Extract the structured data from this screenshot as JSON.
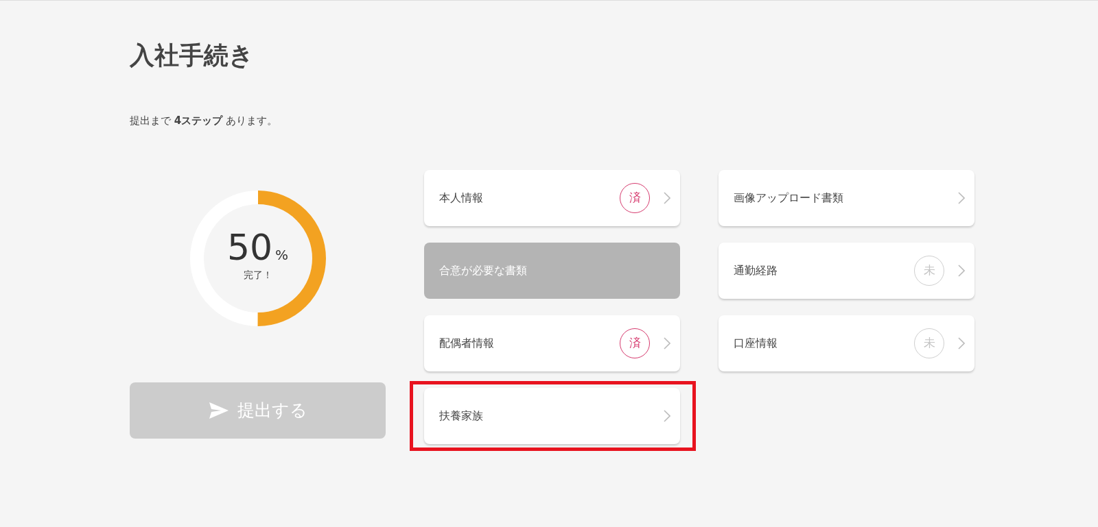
{
  "title": "入社手続き",
  "summary": "提出まで **4ステップ** あります。",
  "progress": {
    "level": 0.5,
    "value": "50",
    "unit": "%",
    "caption": "完了！"
  },
  "submit_button": {
    "label": "提出する",
    "disabled": true
  },
  "columns": [
    [
      {
        "label": "本人情報",
        "disabled": false,
        "highlighted": false,
        "badge": {
          "text": "済",
          "kind": "done"
        }
      },
      {
        "label": "合意が必要な書類",
        "disabled": true,
        "highlighted": false
      },
      {
        "label": "配偶者情報",
        "disabled": false,
        "highlighted": false,
        "badge": {
          "text": "済",
          "kind": "done"
        }
      },
      {
        "label": "扶養家族",
        "disabled": false,
        "highlighted": true
      }
    ],
    [
      {
        "label": "画像アップロード書類",
        "disabled": false,
        "highlighted": false
      },
      {
        "label": "通勤経路",
        "disabled": false,
        "highlighted": false,
        "badge": {
          "text": "未",
          "kind": "pending"
        }
      },
      {
        "label": "口座情報",
        "disabled": false,
        "highlighted": false,
        "badge": {
          "text": "未",
          "kind": "pending"
        }
      }
    ]
  ]
}
